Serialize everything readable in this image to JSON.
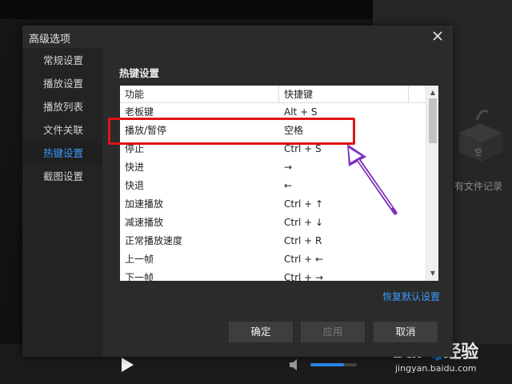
{
  "dialog": {
    "title": "高级选项",
    "section_title": "热键设置",
    "restore_defaults": "恢复默认设置"
  },
  "sidebar": {
    "items": [
      {
        "label": "常规设置"
      },
      {
        "label": "播放设置"
      },
      {
        "label": "播放列表"
      },
      {
        "label": "文件关联"
      },
      {
        "label": "热键设置",
        "active": true
      },
      {
        "label": "截图设置"
      }
    ]
  },
  "hotkeys": {
    "columns": [
      "功能",
      "快捷键"
    ],
    "rows": [
      {
        "function": "老板键",
        "key": "Alt + S"
      },
      {
        "function": "播放/暂停",
        "key": "空格"
      },
      {
        "function": "停止",
        "key": "Ctrl + S"
      },
      {
        "function": "快进",
        "key": "→"
      },
      {
        "function": "快退",
        "key": "←"
      },
      {
        "function": "加速播放",
        "key": "Ctrl + ↑"
      },
      {
        "function": "减速播放",
        "key": "Ctrl + ↓"
      },
      {
        "function": "正常播放速度",
        "key": "Ctrl + R"
      },
      {
        "function": "上一帧",
        "key": "Ctrl + ←"
      },
      {
        "function": "下一帧",
        "key": "Ctrl + →"
      }
    ]
  },
  "buttons": {
    "ok": "确定",
    "apply": "应用",
    "cancel": "取消"
  },
  "player": {
    "empty_label": "有文件记录",
    "empty_box_label": "空",
    "volume_fraction": 0.72
  },
  "watermark": {
    "logo": "Bai",
    "logo_suffix": "经验",
    "url": "jingyan.baidu.com"
  },
  "colors": {
    "accent": "#3c9bff",
    "highlight": "#e01414",
    "annotation_arrow": "#7b2fbf"
  },
  "icons": {
    "close": "close-icon",
    "play": "play-icon",
    "volume": "volume-icon",
    "empty_box": "empty-box-icon"
  }
}
